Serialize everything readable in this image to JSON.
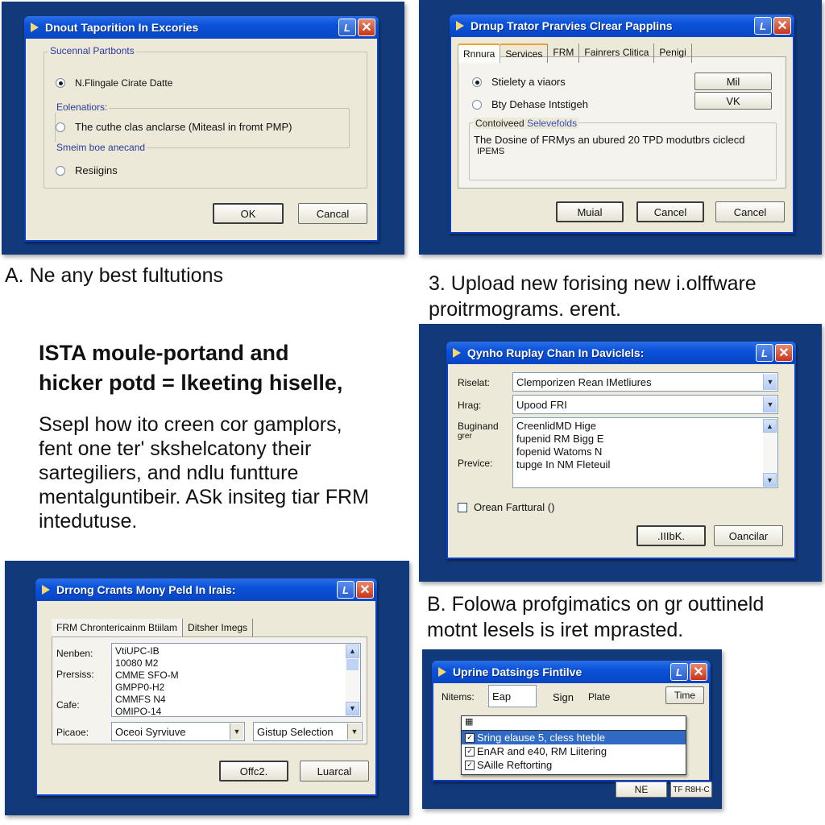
{
  "colors": {
    "panel_bg": "#123a7a",
    "titlebar": "#0a52d9",
    "dialog_bg": "#ece9d8",
    "group_label": "#2c3a9a",
    "selection": "#316ac5",
    "close_button": "#c8341a"
  },
  "dialog1": {
    "title": "Dnout Taporition In Excories",
    "group_main": "Sucennal Partbonts",
    "radio1": "N.Flingale Cirate Datte",
    "group_sub": "Eolenatiors:",
    "radio2": "The cuthe clas anclarse (Miteasl in fromt PMP)",
    "group_sub2": "Smeim boe anecand",
    "radio3": "Resiigins",
    "ok": "OK",
    "cancel": "Cancal"
  },
  "dialog2": {
    "title": "Drnup Trator Prarvies Clrear Papplins",
    "tabs": [
      "Rnnura",
      "Services",
      "FRM",
      "Fainrers  Clitica",
      "Penigi"
    ],
    "radio1": "Stielety a viaors",
    "radio2": "Bty Dehase Intstigeh",
    "side_btn1": "Mil",
    "side_btn2": "VK",
    "group_label_a": "Contoiveed",
    "group_label_b": "Selevefolds",
    "group_text_line1": "The Dosine of FRMys an ubured 20 TPD modutbrs ciclecd",
    "group_text_line2": "IPEMS",
    "btn_a": "Muial",
    "btn_b": "Cancel",
    "btn_c": "Cancel"
  },
  "caption_a": "A.  Ne any best fultutions",
  "caption_3": {
    "line1": "3.  Upload new forising new i.olffware",
    "line2": "proitrmograms. erent."
  },
  "heading": {
    "line1": "ISTA moule-portand and",
    "line2": "hicker potd = lkeeting hiselle,"
  },
  "paragraph": {
    "line1": "Ssepl how ito creen cor gamplors,",
    "line2": "fent one ter' skshelcatony their",
    "line3": "sartegiliers, and ndlu funtture",
    "line4": "mentalguntibeir. ASk insiteg tiar FRM",
    "line5": "intedutuse."
  },
  "dialog3": {
    "title": "Qynho Ruplay Chan In Daviclels:",
    "label_result": "Riselat:",
    "field_result": "Clemporizen Rean IMetliures",
    "label_frag": "Hrag:",
    "field_frag": "Upood FRI",
    "label_buginand": "Buginand",
    "label_buginand2": "grer",
    "label_preview": "Previce:",
    "list_items": [
      "CreenlidMD Hige",
      "fupenid RM Bigg E",
      "fopenid Watoms N",
      "tupge In NM Fleteuil"
    ],
    "checkbox_label": "Orean Farttural ()",
    "checkbox_checked": false,
    "ok": ".IIIbK.",
    "cancel": "Oancilar"
  },
  "caption_b": {
    "line1": "B.  Folowa profgimatics on gr outtineld",
    "line2": "motnt lesels is iret mprasted."
  },
  "dialog4": {
    "title": "Drrong Crants Mony Peld In Irais:",
    "tabs": [
      "FRM Chrontericainm Btiilam",
      "Ditsher Imegs"
    ],
    "label_nember": "Nenben:",
    "label_prersiss": "Prersiss:",
    "label_cafe": "Cafe:",
    "label_picaoe": "Picaoe:",
    "list_items": [
      "VtiUPC-IB",
      "10080 M2",
      "CMME SFO-M",
      "GMPP0-H2",
      "CMMFS N4",
      "OMIPO-14"
    ],
    "select1": "Oceoi Syrviuve",
    "select2": "Gistup Selection",
    "ok": "Offc2.",
    "cancel": "Luarcal"
  },
  "dialog5": {
    "title": "Uprine Datsings Fintilve",
    "label_items": "Nitems:",
    "field_value": "Eap",
    "label_sign": "Sign",
    "label_plate": "Plate",
    "time_button": "Time",
    "dropdown_top": "",
    "options": [
      {
        "label": "Sring elause 5, cless hteble",
        "selected": true,
        "checked": true
      },
      {
        "label": "EnAR and e40, RM Liitering",
        "selected": false,
        "checked": true
      },
      {
        "label": "SAille Reftorting",
        "selected": false,
        "checked": true
      }
    ],
    "btn_ne": "NE",
    "btn_refresh": "TF R8H-C"
  }
}
